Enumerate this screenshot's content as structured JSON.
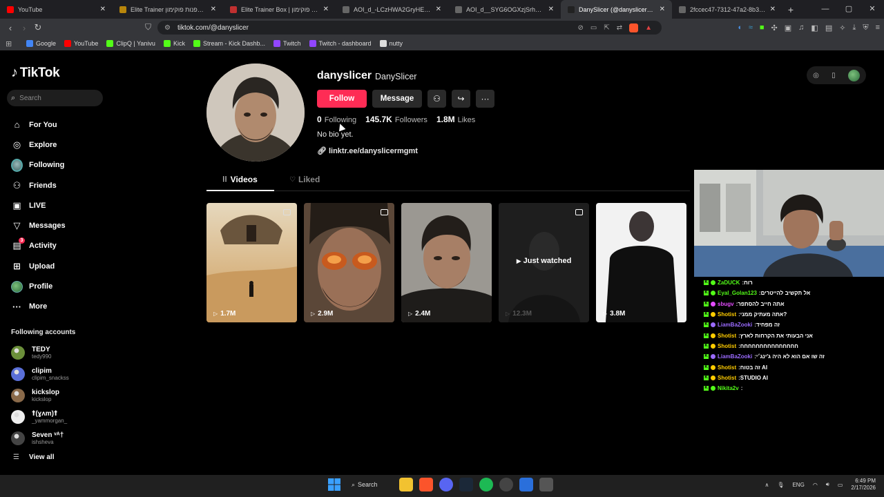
{
  "browser": {
    "tabs": [
      {
        "title": "YouTube",
        "color": "#ff0000"
      },
      {
        "title": "Elite Trainer קלפי אספנות פוקימון",
        "color": "#b8860b"
      },
      {
        "title": "Elite Trainer Box | מארז קלפי פוקימון",
        "color": "#c03030"
      },
      {
        "title": "AOI_d_-LCzHWA2GryHEQ3NQeNiF1e",
        "color": "#666666"
      },
      {
        "title": "AOI_d__SYG6OGXzjSrhBb8DGAlmoA",
        "color": "#666666"
      },
      {
        "title": "DanySlicer (@danyslicer) | TikTok",
        "color": "#222222",
        "active": true
      },
      {
        "title": "2fccec47-7312-47a2-8b38-e2ace97f",
        "color": "#666666"
      }
    ],
    "new_tab": "+",
    "window_controls": {
      "minimize": "—",
      "maximize": "▢",
      "close": "✕"
    },
    "url": "tiktok.com/@danyslicer",
    "bookmarks": [
      {
        "label": "Google",
        "color": "#4285f4"
      },
      {
        "label": "YouTube",
        "color": "#ff0000"
      },
      {
        "label": "ClipQ | Yanivu",
        "color": "#53fc18"
      },
      {
        "label": "Kick",
        "color": "#53fc18"
      },
      {
        "label": "Stream - Kick Dashb...",
        "color": "#53fc18"
      },
      {
        "label": "Twitch",
        "color": "#9146ff"
      },
      {
        "label": "Twitch - dashboard",
        "color": "#9146ff"
      },
      {
        "label": "nutty",
        "color": "#dddddd"
      }
    ]
  },
  "sidebar": {
    "logo": "TikTok",
    "search_placeholder": "Search",
    "nav": [
      {
        "label": "For You",
        "icon": "home-icon"
      },
      {
        "label": "Explore",
        "icon": "compass-icon"
      },
      {
        "label": "Following",
        "icon": "following-avatar-icon"
      },
      {
        "label": "Friends",
        "icon": "friends-icon"
      },
      {
        "label": "LIVE",
        "icon": "live-icon"
      },
      {
        "label": "Messages",
        "icon": "messages-icon"
      },
      {
        "label": "Activity",
        "icon": "activity-icon",
        "badge": "3"
      },
      {
        "label": "Upload",
        "icon": "upload-icon"
      },
      {
        "label": "Profile",
        "icon": "profile-avatar-icon"
      },
      {
        "label": "More",
        "icon": "more-icon"
      }
    ],
    "following_title": "Following accounts",
    "following_accounts": [
      {
        "name": "TEDY",
        "user": "tedy990",
        "color": "#6b8f3a"
      },
      {
        "name": "clipim",
        "user": "clipim_snackss",
        "color": "#5a6fd8"
      },
      {
        "name": "kickslop",
        "user": "kickslop",
        "color": "#8a6a4a"
      },
      {
        "name": "ꝉ(ɣʌm)ꝉ",
        "user": "_yammorgan_",
        "color": "#eeeeee"
      },
      {
        "name": "Seven ᵛᴬ†",
        "user": "ishsheva",
        "color": "#444444"
      }
    ],
    "view_all": "View all"
  },
  "profile": {
    "username": "danyslicer",
    "display_name": "DanySlicer",
    "follow_label": "Follow",
    "message_label": "Message",
    "following_count": "0",
    "following_label": "Following",
    "followers_count": "145.7K",
    "followers_label": "Followers",
    "likes_count": "1.8M",
    "likes_label": "Likes",
    "bio": "No bio yet.",
    "link": "linktr.ee/danyslicermgmt",
    "tabs": {
      "videos": "Videos",
      "liked": "Liked"
    }
  },
  "videos": [
    {
      "views": "1.7M",
      "multi": true
    },
    {
      "views": "2.9M",
      "multi": true
    },
    {
      "views": "2.4M",
      "multi": false
    },
    {
      "views": "12.3M",
      "multi": true,
      "watched_label": "Just watched"
    },
    {
      "views": "3.8M",
      "multi": false
    }
  ],
  "chat": [
    {
      "user": "ZaDUCK",
      "msg": "רוח",
      "color": "#53fc18"
    },
    {
      "user": "Eyal_Golan123",
      "msg": "אל תקשיב להייטרים",
      "color": "#53fc18"
    },
    {
      "user": "sbugv",
      "msg": "אתה חייב להסתפר",
      "color": "#e44cff"
    },
    {
      "user": "Shotist",
      "msg": "אתה מעתיק ממני?",
      "color": "#ffcc00"
    },
    {
      "user": "LiamBaZooki",
      "msg": "זה מפחיד",
      "color": "#9b6bff"
    },
    {
      "user": "Shotist",
      "msg": "אני הבעותי את הקרחות לארץ",
      "color": "#ffcc00"
    },
    {
      "user": "Shotist",
      "msg": "חחחחחחחחחחחחחחח",
      "color": "#ffcc00"
    },
    {
      "user": "LiamBaZooki",
      "msg": "זה שו אם הוא לא היה ג'ינג׳י",
      "color": "#9b6bff"
    },
    {
      "user": "Shotist",
      "msg": "זה בטוח AI",
      "color": "#ffcc00"
    },
    {
      "user": "Shotist",
      "msg": "STUDIO AI",
      "color": "#ffcc00"
    },
    {
      "user": "Nikita2v",
      "msg": "",
      "color": "#53fc18"
    }
  ],
  "taskbar": {
    "search_label": "Search",
    "lang": "ENG",
    "time": "6:49 PM",
    "date": "2/17/2026"
  }
}
